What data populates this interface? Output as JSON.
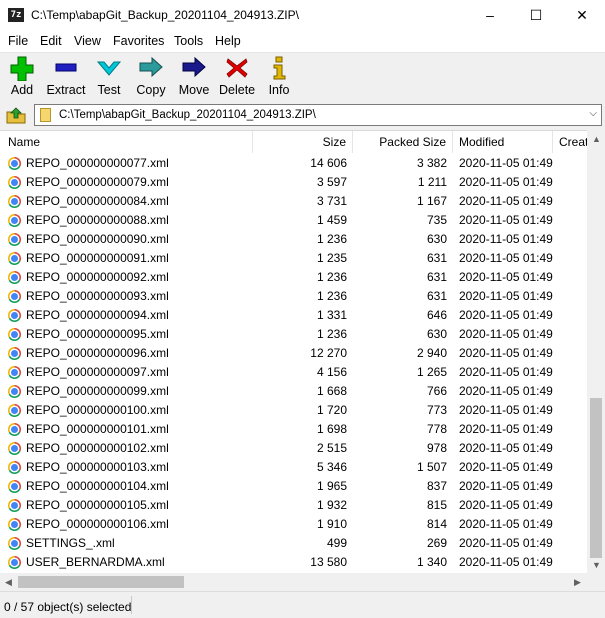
{
  "window": {
    "title": "C:\\Temp\\abapGit_Backup_20201104_204913.ZIP\\",
    "icon_text": "7z",
    "controls": [
      "–",
      "☐",
      "✕"
    ]
  },
  "menu": [
    "File",
    "Edit",
    "View",
    "Favorites",
    "Tools",
    "Help"
  ],
  "toolbar": [
    {
      "label": "Add",
      "icon": "plus-icon",
      "color": "#00c000"
    },
    {
      "label": "Extract",
      "icon": "minus-icon",
      "color": "#2020c0"
    },
    {
      "label": "Test",
      "icon": "check-chevron-icon",
      "color": "#00b8c8"
    },
    {
      "label": "Copy",
      "icon": "copy-arrow-icon",
      "color": "#2a8a8a"
    },
    {
      "label": "Move",
      "icon": "move-arrow-icon",
      "color": "#1a1a8c"
    },
    {
      "label": "Delete",
      "icon": "x-icon",
      "color": "#e00000"
    },
    {
      "label": "Info",
      "icon": "info-icon",
      "color": "#d8b000"
    }
  ],
  "address": {
    "path": "C:\\Temp\\abapGit_Backup_20201104_204913.ZIP\\"
  },
  "columns": [
    "Name",
    "Size",
    "Packed Size",
    "Modified",
    "Creat"
  ],
  "files": [
    {
      "name": "REPO_000000000077.xml",
      "size": "14 606",
      "packed": "3 382",
      "modified": "2020-11-05 01:49"
    },
    {
      "name": "REPO_000000000079.xml",
      "size": "3 597",
      "packed": "1 211",
      "modified": "2020-11-05 01:49"
    },
    {
      "name": "REPO_000000000084.xml",
      "size": "3 731",
      "packed": "1 167",
      "modified": "2020-11-05 01:49"
    },
    {
      "name": "REPO_000000000088.xml",
      "size": "1 459",
      "packed": "735",
      "modified": "2020-11-05 01:49"
    },
    {
      "name": "REPO_000000000090.xml",
      "size": "1 236",
      "packed": "630",
      "modified": "2020-11-05 01:49"
    },
    {
      "name": "REPO_000000000091.xml",
      "size": "1 235",
      "packed": "631",
      "modified": "2020-11-05 01:49"
    },
    {
      "name": "REPO_000000000092.xml",
      "size": "1 236",
      "packed": "631",
      "modified": "2020-11-05 01:49"
    },
    {
      "name": "REPO_000000000093.xml",
      "size": "1 236",
      "packed": "631",
      "modified": "2020-11-05 01:49"
    },
    {
      "name": "REPO_000000000094.xml",
      "size": "1 331",
      "packed": "646",
      "modified": "2020-11-05 01:49"
    },
    {
      "name": "REPO_000000000095.xml",
      "size": "1 236",
      "packed": "630",
      "modified": "2020-11-05 01:49"
    },
    {
      "name": "REPO_000000000096.xml",
      "size": "12 270",
      "packed": "2 940",
      "modified": "2020-11-05 01:49"
    },
    {
      "name": "REPO_000000000097.xml",
      "size": "4 156",
      "packed": "1 265",
      "modified": "2020-11-05 01:49"
    },
    {
      "name": "REPO_000000000099.xml",
      "size": "1 668",
      "packed": "766",
      "modified": "2020-11-05 01:49"
    },
    {
      "name": "REPO_000000000100.xml",
      "size": "1 720",
      "packed": "773",
      "modified": "2020-11-05 01:49"
    },
    {
      "name": "REPO_000000000101.xml",
      "size": "1 698",
      "packed": "778",
      "modified": "2020-11-05 01:49"
    },
    {
      "name": "REPO_000000000102.xml",
      "size": "2 515",
      "packed": "978",
      "modified": "2020-11-05 01:49"
    },
    {
      "name": "REPO_000000000103.xml",
      "size": "5 346",
      "packed": "1 507",
      "modified": "2020-11-05 01:49"
    },
    {
      "name": "REPO_000000000104.xml",
      "size": "1 965",
      "packed": "837",
      "modified": "2020-11-05 01:49"
    },
    {
      "name": "REPO_000000000105.xml",
      "size": "1 932",
      "packed": "815",
      "modified": "2020-11-05 01:49"
    },
    {
      "name": "REPO_000000000106.xml",
      "size": "1 910",
      "packed": "814",
      "modified": "2020-11-05 01:49"
    },
    {
      "name": "SETTINGS_.xml",
      "size": "499",
      "packed": "269",
      "modified": "2020-11-05 01:49"
    },
    {
      "name": "USER_BERNARDMA.xml",
      "size": "13 580",
      "packed": "1 340",
      "modified": "2020-11-05 01:49"
    }
  ],
  "status": {
    "selection": "0 / 57 object(s) selected"
  }
}
